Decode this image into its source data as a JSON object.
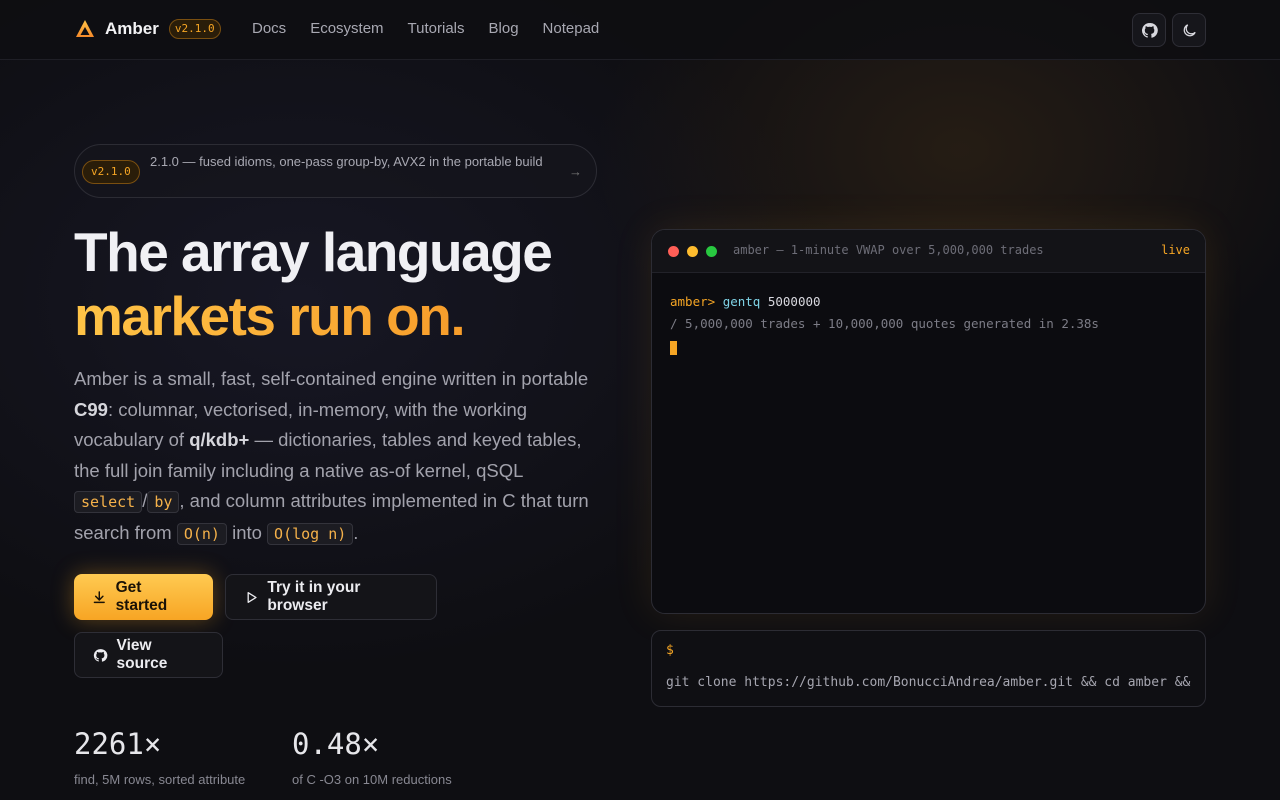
{
  "nav": {
    "brand": "Amber",
    "version": "v2.1.0",
    "links": [
      "Docs",
      "Ecosystem",
      "Tutorials",
      "Blog",
      "Notepad"
    ]
  },
  "announce": {
    "badge": "v2.1.0",
    "text": "2.1.0 — fused idioms, one-pass group-by, AVX2 in the portable build",
    "arrow": "→"
  },
  "hero": {
    "title_line1": "The array language",
    "title_line2": "markets run on.",
    "lede": {
      "p1": "Amber is a small, fast, self-contained engine written in portable ",
      "c99": "C99",
      "p2": ": columnar, vectorised, in-memory, with the working vocabulary of ",
      "qkdb": "q/kdb+",
      "p3": " — dictionaries, tables and keyed tables, the full join family including a native as-of kernel, qSQL ",
      "code_select": "select",
      "slash": "/",
      "code_by": "by",
      "p4": ", and column attributes implemented in C that turn search from ",
      "code_on": "O(n)",
      "p5": " into ",
      "code_logn": "O(log n)",
      "p6": "."
    }
  },
  "buttons": {
    "get_started": "Get started",
    "try_browser": "Try it in your browser",
    "view_source": "View source"
  },
  "stats": [
    {
      "value": "2261×",
      "label": "find, 5M rows, sorted attribute"
    },
    {
      "value": "0.48×",
      "label": "of C -O3 on 10M reductions"
    }
  ],
  "terminal": {
    "title": "amber — 1-minute VWAP over 5,000,000 trades",
    "status": "live",
    "prompt": "amber>",
    "command": "gentq",
    "argument": "5000000",
    "output": "/ 5,000,000 trades + 10,000,000 quotes generated in 2.38s"
  },
  "install": {
    "prompt": "$",
    "command": "git clone https://github.com/BonucciAndrea/amber.git && cd amber &&"
  },
  "colors": {
    "accent": "#f5a524",
    "background": "#0e0e12",
    "dot_red": "#ff5f57",
    "dot_yellow": "#febc2e",
    "dot_green": "#28c840"
  }
}
